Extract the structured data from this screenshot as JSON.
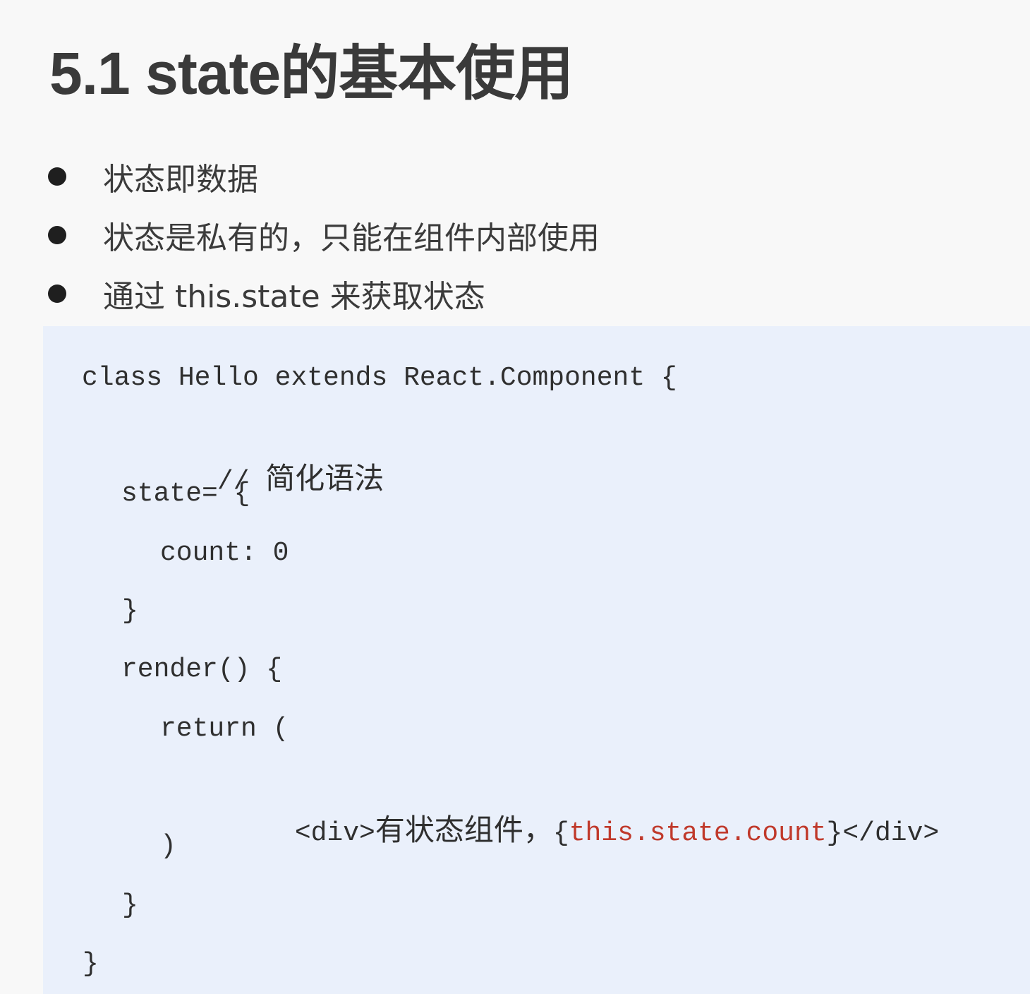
{
  "slide": {
    "title": "5.1 state的基本使用",
    "bullets": [
      "状态即数据",
      "状态是私有的，只能在组件内部使用",
      "通过 this.state 来获取状态"
    ]
  },
  "code": {
    "line1": "class Hello extends React.Component {",
    "line2_slash": "// ",
    "line2_comment": "简化语法",
    "line3": "state= {",
    "line4": "count: 0",
    "line5": "}",
    "line6": "render() {",
    "line7": "return (",
    "line8_open": "<div>",
    "line8_text": "有状态组件，",
    "line8_brace_open": "{",
    "line8_expr": "this.state.count",
    "line8_brace_close": "}",
    "line8_close": "</div>",
    "line9": ")",
    "line10": "}",
    "line11": "}"
  },
  "colors": {
    "code_background": "#eaf0fb",
    "expression": "#c0392b",
    "text": "#2f2f2f"
  }
}
